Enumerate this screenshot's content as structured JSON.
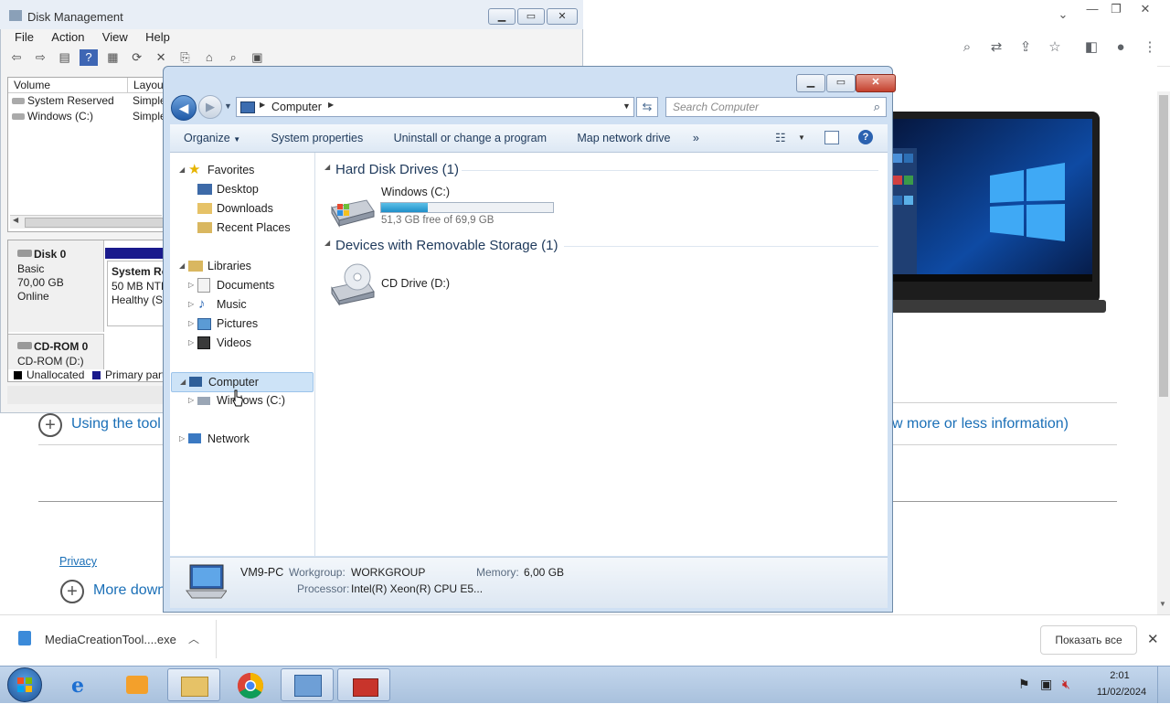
{
  "chrome": {
    "download_item": "MediaCreationTool....exe",
    "show_all": "Показать все",
    "links": {
      "using_tool": "Using the tool",
      "view_more": "w more or less information)",
      "privacy": "Privacy",
      "more_down": "More down"
    }
  },
  "disk_mgmt": {
    "title": "Disk Management",
    "menu": [
      "File",
      "Action",
      "View",
      "Help"
    ],
    "columns": [
      "Volume",
      "Layout"
    ],
    "volumes": [
      {
        "name": "System Reserved",
        "layout": "Simple"
      },
      {
        "name": "Windows (C:)",
        "layout": "Simple"
      }
    ],
    "disk0": {
      "label": "Disk 0",
      "type": "Basic",
      "size": "70,00 GB",
      "status": "Online"
    },
    "partition": {
      "name": "System Re",
      "detail": "50 MB NTF",
      "health": "Healthy (Sy"
    },
    "cdrom": {
      "label": "CD-ROM 0",
      "sub": "CD-ROM (D:)"
    },
    "legend": {
      "unallocated": "Unallocated",
      "primary": "Primary part"
    }
  },
  "explorer": {
    "address": "Computer",
    "search_placeholder": "Search Computer",
    "commands": [
      "Organize",
      "System properties",
      "Uninstall or change a program",
      "Map network drive",
      "»"
    ],
    "nav": {
      "favorites": "Favorites",
      "desktop": "Desktop",
      "downloads": "Downloads",
      "recent": "Recent Places",
      "libraries": "Libraries",
      "documents": "Documents",
      "music": "Music",
      "pictures": "Pictures",
      "videos": "Videos",
      "computer": "Computer",
      "windows_c": "Windows (C:)",
      "network": "Network"
    },
    "groups": {
      "hdd": "Hard Disk Drives (1)",
      "removable": "Devices with Removable Storage (1)"
    },
    "drive_c": {
      "name": "Windows (C:)",
      "free": "51,3 GB free of 69,9 GB",
      "used_fraction": 0.27
    },
    "drive_d": {
      "name": "CD Drive (D:)"
    },
    "details": {
      "pc_name": "VM9-PC",
      "workgroup_label": "Workgroup:",
      "workgroup": "WORKGROUP",
      "memory_label": "Memory:",
      "memory": "6,00 GB",
      "processor_label": "Processor:",
      "processor": "Intel(R) Xeon(R) CPU E5..."
    }
  },
  "taskbar": {
    "time": "2:01",
    "date": "11/02/2024"
  }
}
